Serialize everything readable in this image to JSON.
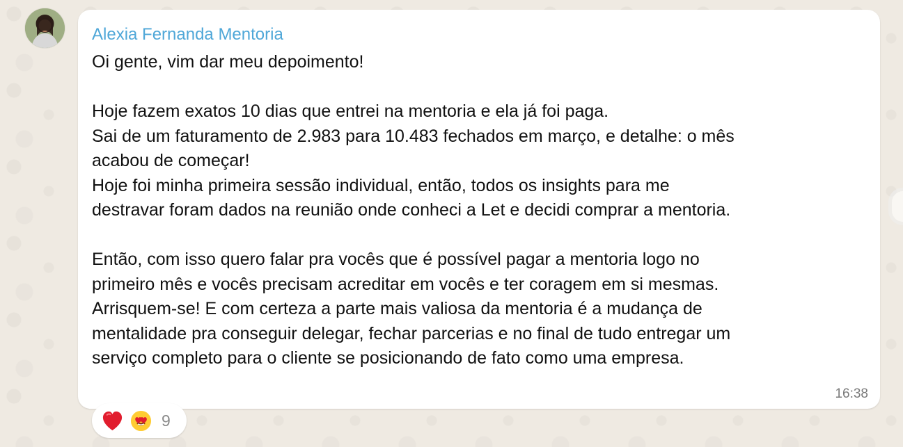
{
  "message": {
    "sender": "Alexia Fernanda Mentoria",
    "lines": {
      "l1": "Oi gente, vim dar meu depoimento!",
      "l2": "Hoje fazem exatos 10 dias que entrei na mentoria e ela já foi paga.",
      "l3": "Sai de um faturamento de 2.983 para 10.483 fechados em março, e detalhe: o mês",
      "l4": "acabou de começar!",
      "l5": "Hoje foi minha primeira sessão individual, então, todos os insights para me",
      "l6": "destravar foram dados na reunião onde conheci a Let e decidi comprar a mentoria.",
      "l7": "Então, com isso quero falar pra vocês que é possível pagar a mentoria logo no",
      "l8": "primeiro mês e vocês precisam acreditar em vocês e ter coragem em si mesmas.",
      "l9": "Arrisquem-se! E com certeza a parte mais valiosa da mentoria é a mudança de",
      "l10": "mentalidade pra conseguir delegar, fechar parcerias e no final de tudo entregar um",
      "l11": "serviço completo para o cliente se posicionando de fato como uma empresa."
    },
    "time": "16:38"
  },
  "reactions": {
    "items": [
      "heart-icon",
      "heart-eyes-icon"
    ],
    "count": "9"
  },
  "colors": {
    "sender": "#4fa7d8",
    "background": "#efeae2",
    "bubble": "#ffffff",
    "timestamp": "#7a7a7a",
    "heart": "#e11d2e",
    "emoji_face": "#ffcc33"
  }
}
